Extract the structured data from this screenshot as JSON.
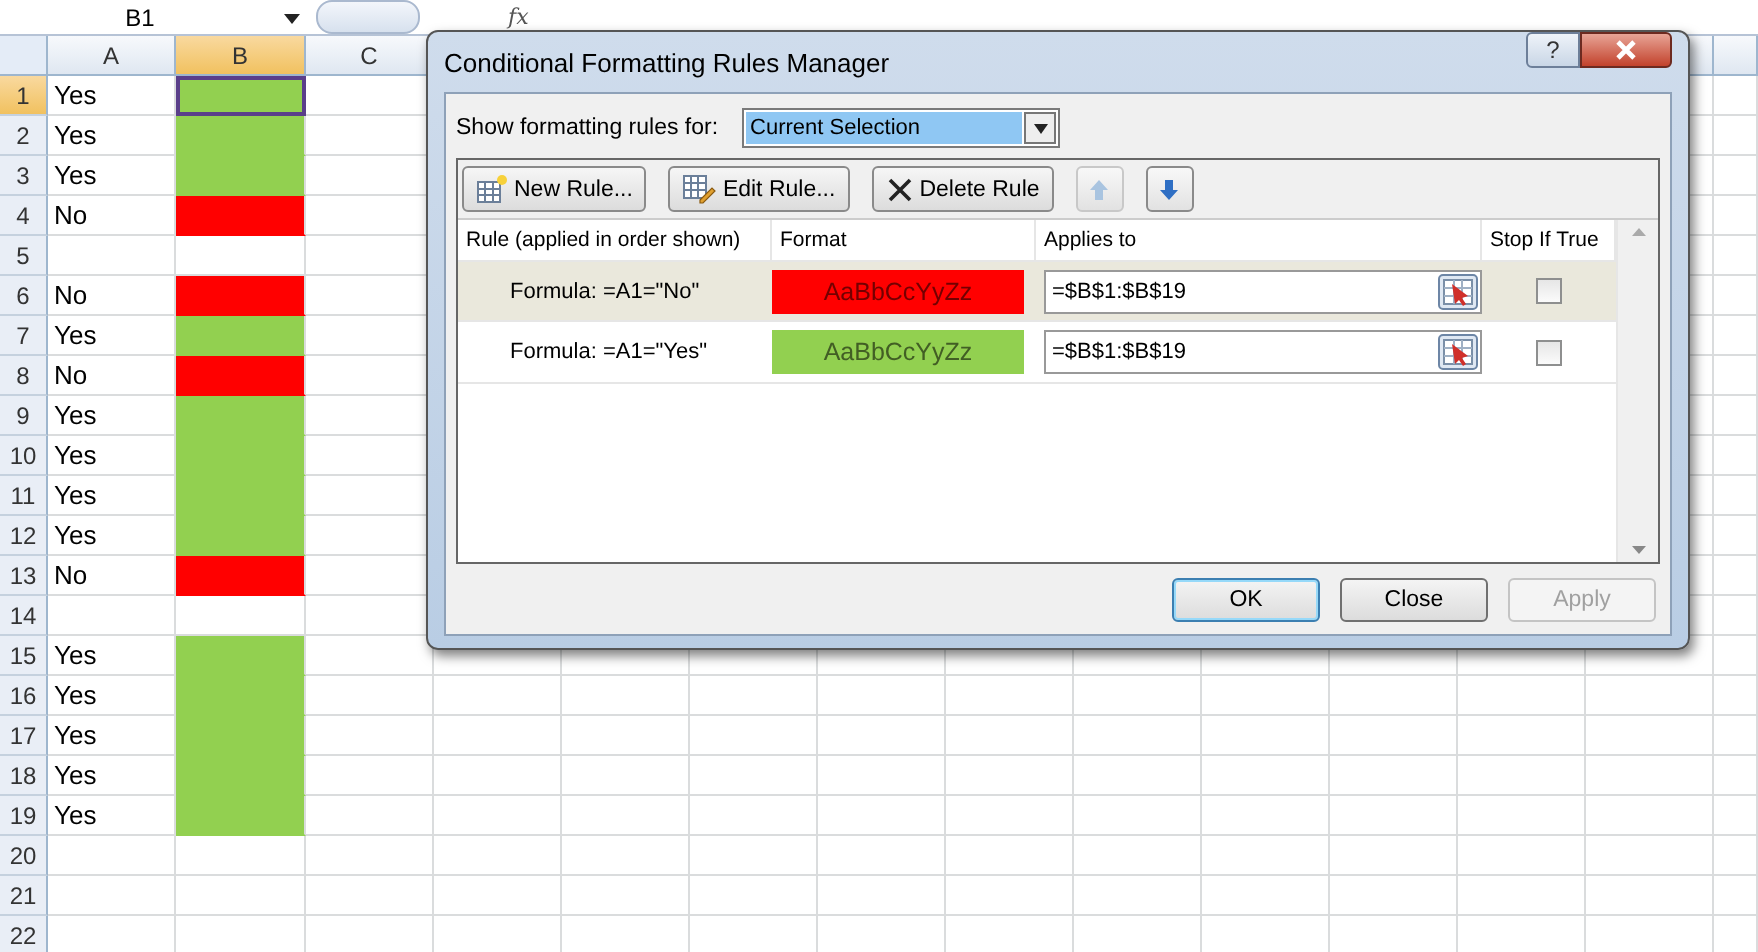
{
  "formula_bar": {
    "name_box": "B1",
    "function_label": "fx"
  },
  "columns": [
    {
      "label": "A",
      "selected": false
    },
    {
      "label": "B",
      "selected": true
    },
    {
      "label": "C",
      "selected": false
    }
  ],
  "rows": [
    {
      "number": "1",
      "a": "Yes",
      "color": "#92d050",
      "selected": true
    },
    {
      "number": "2",
      "a": "Yes",
      "color": "#92d050",
      "selected": false
    },
    {
      "number": "3",
      "a": "Yes",
      "color": "#92d050",
      "selected": false
    },
    {
      "number": "4",
      "a": "No",
      "color": "#ff0000",
      "selected": false
    },
    {
      "number": "5",
      "color": "#ffffff",
      "selected": false
    },
    {
      "number": "6",
      "a": "No",
      "color": "#ff0000",
      "selected": false
    },
    {
      "number": "7",
      "a": "Yes",
      "color": "#92d050",
      "selected": false
    },
    {
      "number": "8",
      "a": "No",
      "color": "#ff0000",
      "selected": false
    },
    {
      "number": "9",
      "a": "Yes",
      "color": "#92d050",
      "selected": false
    },
    {
      "number": "10",
      "a": "Yes",
      "color": "#92d050",
      "selected": false
    },
    {
      "number": "11",
      "a": "Yes",
      "color": "#92d050",
      "selected": false
    },
    {
      "number": "12",
      "a": "Yes",
      "color": "#92d050",
      "selected": false
    },
    {
      "number": "13",
      "a": "No",
      "color": "#ff0000",
      "selected": false
    },
    {
      "number": "14",
      "color": "#ffffff",
      "selected": false
    },
    {
      "number": "15",
      "a": "Yes",
      "color": "#92d050",
      "selected": false
    },
    {
      "number": "16",
      "a": "Yes",
      "color": "#92d050",
      "selected": false
    },
    {
      "number": "17",
      "a": "Yes",
      "color": "#92d050",
      "selected": false
    },
    {
      "number": "18",
      "a": "Yes",
      "color": "#92d050",
      "selected": false
    },
    {
      "number": "19",
      "a": "Yes",
      "color": "#92d050",
      "selected": false
    },
    {
      "number": "20",
      "selected": false
    },
    {
      "number": "21",
      "selected": false
    },
    {
      "number": "22",
      "selected": false
    }
  ],
  "dialog": {
    "title": "Conditional Formatting Rules Manager",
    "help": "?",
    "show_label": "Show formatting rules for:",
    "show_value": "Current Selection",
    "toolbar": [
      {
        "label": "New Rule...",
        "kind": "new"
      },
      {
        "label": "Edit Rule...",
        "kind": "edit"
      },
      {
        "label": "Delete Rule",
        "kind": "delete"
      },
      {
        "kind": "up"
      },
      {
        "kind": "down"
      }
    ],
    "table_columns": [
      "Rule (applied in order shown)",
      "Format",
      "Applies to",
      "Stop If True"
    ],
    "rules": [
      {
        "rule": "Formula: =A1=\"No\"",
        "preview": "AaBbCcYyZz",
        "color": "#ff0000",
        "applies_to": "=$B$1:$B$19",
        "stop_if_true": false,
        "selected": true
      },
      {
        "rule": "Formula: =A1=\"Yes\"",
        "preview": "AaBbCcYyZz",
        "color": "#92d050",
        "applies_to": "=$B$1:$B$19",
        "stop_if_true": false,
        "selected": false
      }
    ],
    "buttons": [
      {
        "label": "OK",
        "default": true,
        "disabled": false
      },
      {
        "label": "Close",
        "default": false,
        "disabled": false
      },
      {
        "label": "Apply",
        "default": false,
        "disabled": true
      }
    ]
  }
}
